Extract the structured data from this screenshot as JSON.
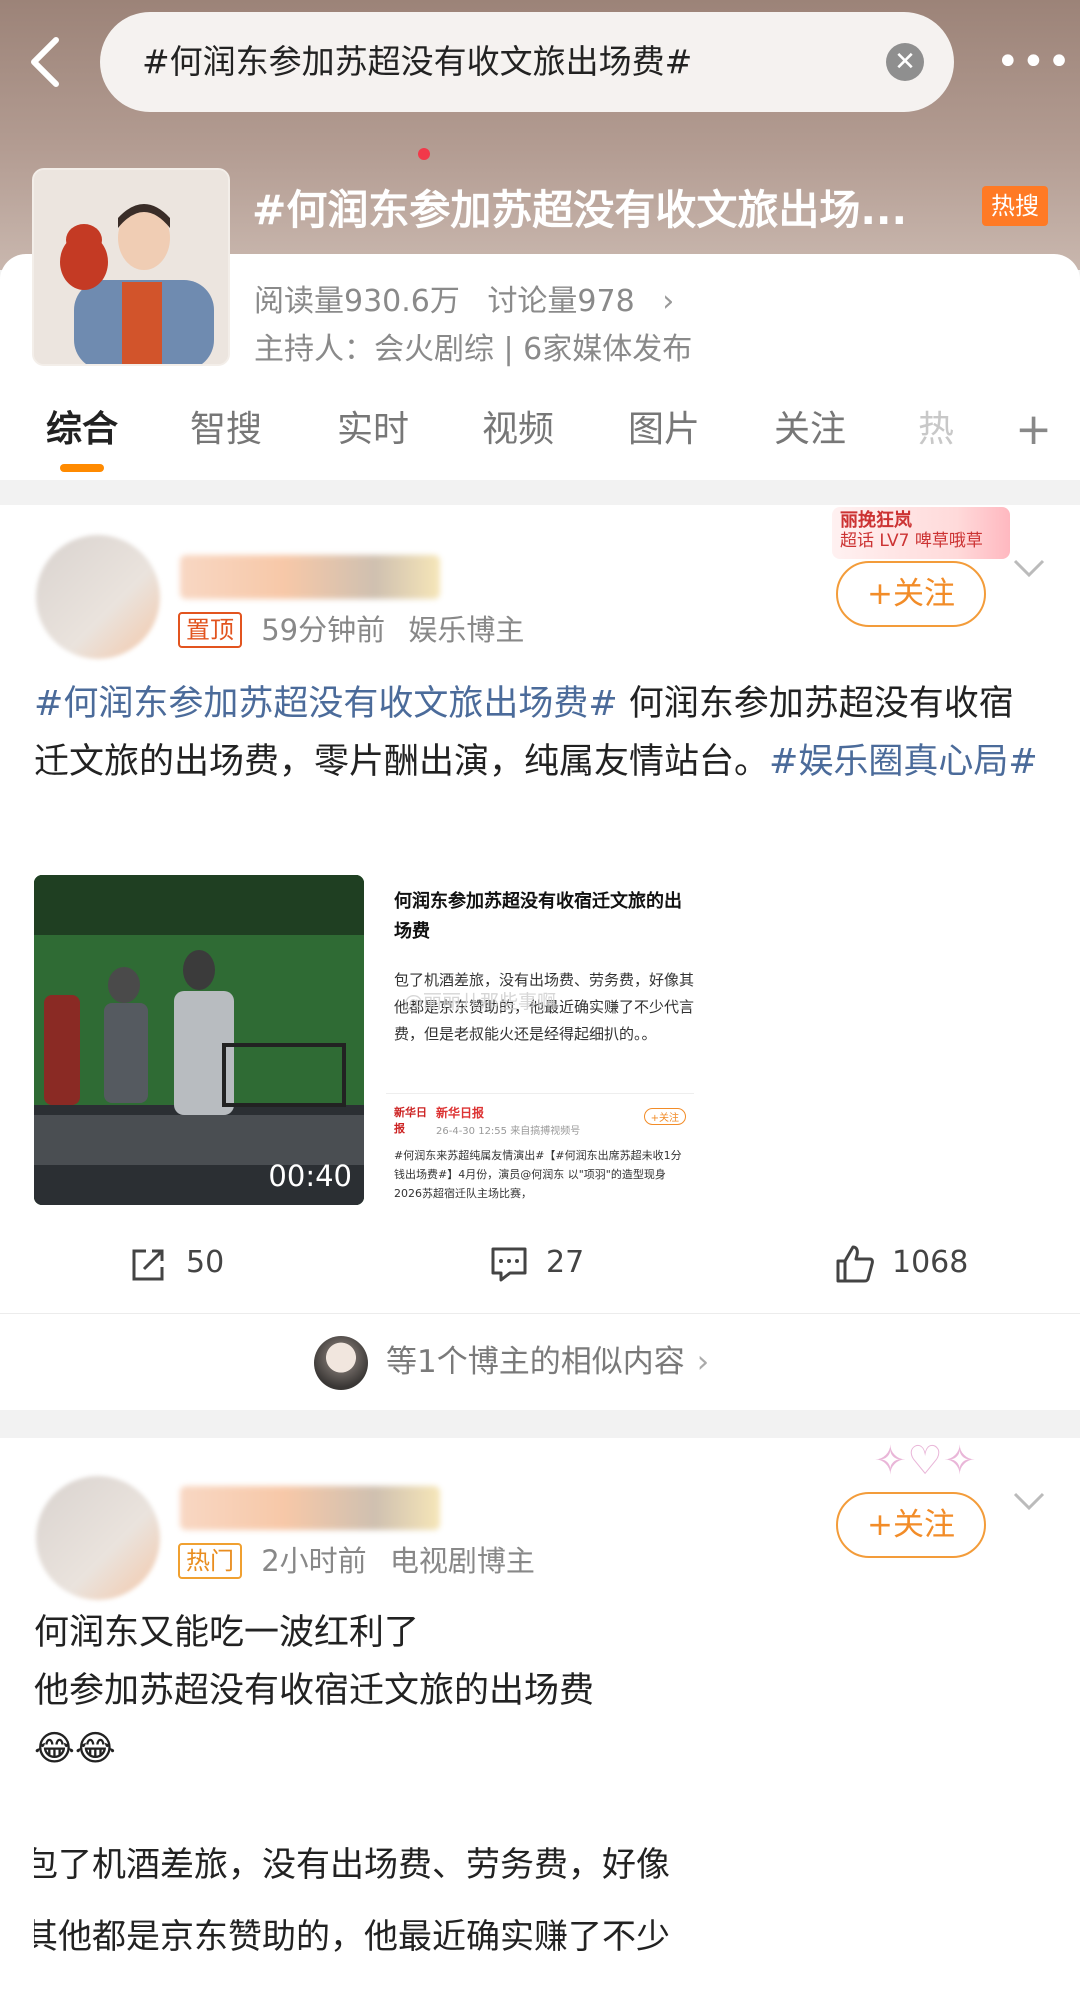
{
  "search": {
    "query": "#何润东参加苏超没有收文旅出场费#"
  },
  "topic": {
    "title": "#何润东参加苏超没有收文旅出场...",
    "badge": "热搜",
    "reads": "阅读量930.6万",
    "discussions": "讨论量978",
    "host": "主持人：会火剧综 | 6家媒体发布"
  },
  "tabs": [
    {
      "label": "综合",
      "active": true
    },
    {
      "label": "智搜"
    },
    {
      "label": "实时",
      "has_dot": true
    },
    {
      "label": "视频"
    },
    {
      "label": "图片"
    },
    {
      "label": "关注"
    },
    {
      "label": "热"
    }
  ],
  "posts": [
    {
      "tag": "置顶",
      "time": "59分钟前",
      "author_type": "娱乐博主",
      "follow_label": "+关注",
      "badge_name": "丽挽狂岚",
      "badge_sub": "超话 LV7 啤草哦草",
      "text_hashtag1": "#何润东参加苏超没有收文旅出场费#",
      "text_body": " 何润东参加苏超没有收宿迁文旅的出场费，零片酬出演，纯属友情站台。",
      "text_hashtag2": "#娱乐圈真心局#",
      "video_duration": "00:40",
      "article": {
        "title": "何润东参加苏超没有收宿迁文旅的出场费",
        "body": "包了机酒差旅，没有出场费、劳务费，好像其他都是京东赞助的，他最近确实赚了不少代言费，但是老叔能火还是经得起细扒的。。",
        "watermark": "@丽丽儿那些事啊",
        "source_logo": "新华日报",
        "source_name": "新华日报",
        "source_time": "26-4-30 12:55 来自搞搏视频号",
        "source_follow": "+关注",
        "source_text": "#何润东来苏超纯属友情演出#【#何润东出席苏超未收1分钱出场费#】4月份，演员@何润东 以\"项羽\"的造型现身2026苏超宿迁队主场比赛，"
      },
      "reposts": "50",
      "comments": "27",
      "likes": "1068",
      "similar": "等1个博主的相似内容"
    },
    {
      "tag": "热门",
      "time": "2小时前",
      "author_type": "电视剧博主",
      "follow_label": "+关注",
      "line1": "何润东又能吃一波红利了",
      "line2": "他参加苏超没有收宿迁文旅的出场费",
      "emojis": "😂😂",
      "quote1": "包了机酒差旅，没有出场费、劳务费，好像",
      "quote2": "其他都是京东赞助的，他最近确实赚了不少"
    }
  ],
  "colors": {
    "accent": "#f28c28",
    "hashtag": "#4b6b9a",
    "hot": "#ff7a25"
  }
}
